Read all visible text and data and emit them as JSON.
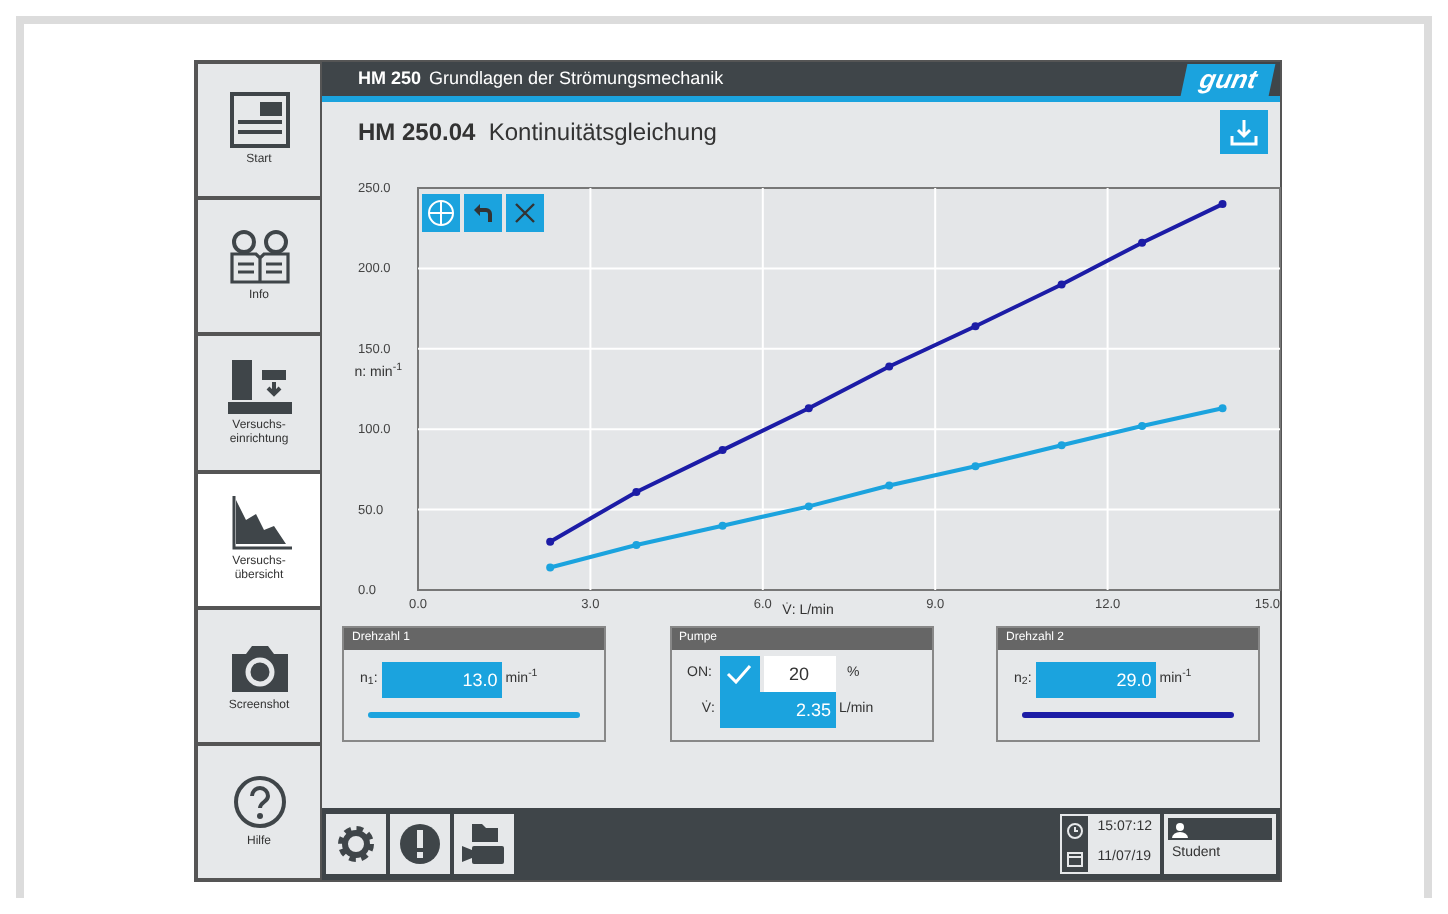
{
  "header": {
    "product": "HM 250",
    "title": "Grundlagen der Strömungsmechanik",
    "logo": "gunt"
  },
  "sidebar": {
    "items": [
      {
        "kind": "start",
        "label": "Start",
        "selected": false
      },
      {
        "kind": "info",
        "label": "Info",
        "selected": false
      },
      {
        "kind": "setup",
        "label": "Versuchs-einrichtung",
        "selected": false
      },
      {
        "kind": "overview",
        "label": "Versuchs-übersicht",
        "selected": true
      },
      {
        "kind": "screenshot",
        "label": "Screenshot",
        "selected": false
      },
      {
        "kind": "help",
        "label": "Hilfe",
        "selected": false
      }
    ]
  },
  "experiment": {
    "code": "HM 250.04",
    "title": "Kontinuitätsgleichung"
  },
  "chart_data": {
    "type": "line",
    "grid": true,
    "xlabel": "V̇: L/min",
    "ylabel": "n: min$^{-1}$",
    "xlim": [
      0,
      15
    ],
    "ylim": [
      0,
      250
    ],
    "xticks": [
      {
        "value": 0,
        "label": "0.0"
      },
      {
        "value": 3,
        "label": "3.0"
      },
      {
        "value": 6,
        "label": "6.0"
      },
      {
        "value": 9,
        "label": "9.0"
      },
      {
        "value": 12,
        "label": "12.0"
      },
      {
        "value": 15,
        "label": "15.0"
      }
    ],
    "yticks": [
      {
        "value": 0,
        "label": "0.0"
      },
      {
        "value": 50,
        "label": "50.0"
      },
      {
        "value": 100,
        "label": "100.0"
      },
      {
        "value": 150,
        "label": "150.0"
      },
      {
        "value": 200,
        "label": "200.0"
      },
      {
        "value": 250,
        "label": "250.0"
      }
    ],
    "x": [
      2.3,
      3.8,
      5.3,
      6.8,
      8.2,
      9.7,
      11.2,
      12.6,
      14.0
    ],
    "series": [
      {
        "color": "#1c1ca6",
        "marker": "circle",
        "values": [
          30,
          61,
          87,
          113,
          139,
          164,
          190,
          216,
          240
        ]
      },
      {
        "color": "#1ba3de",
        "marker": "circle",
        "values": [
          14,
          28,
          40,
          52,
          65,
          77,
          90,
          102,
          113
        ]
      }
    ]
  },
  "panels": [
    {
      "kind": "speed",
      "title": "Drehzahl 1",
      "label": "n$_{1}$:",
      "value": "13.0",
      "unit": "min$^{-1}$",
      "color": "#1ba3de"
    },
    {
      "kind": "pump",
      "title": "Pumpe",
      "on_label": "ON:",
      "checked": true,
      "value": "20",
      "unit": "%",
      "flow_label": "V̇:",
      "flow_value": "2.35",
      "flow_unit": "L/min"
    },
    {
      "kind": "speed",
      "title": "Drehzahl 2",
      "label": "n$_{2}$:",
      "value": "29.0",
      "unit": "min$^{-1}$",
      "color": "#1c1ca6"
    }
  ],
  "status_bar": {
    "time": "15:07:12",
    "date": "11/07/19",
    "user": "Student"
  }
}
